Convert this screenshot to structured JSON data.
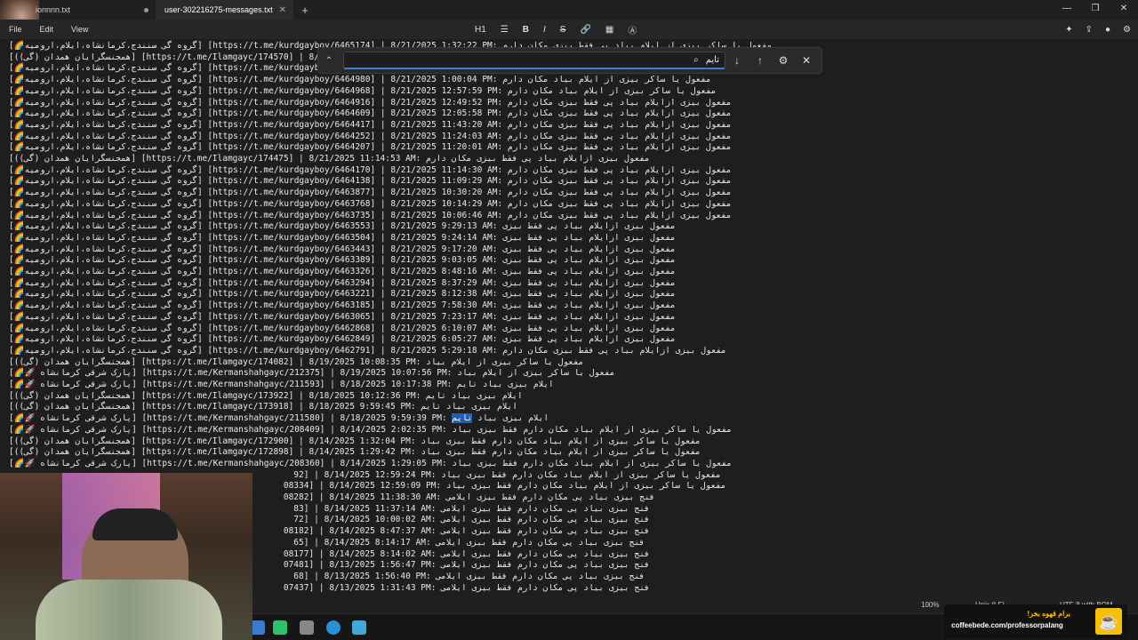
{
  "window": {
    "tabs": [
      {
        "label": "ionnnn.txt",
        "active": false
      },
      {
        "label": "user-302216275-messages.txt",
        "active": true
      }
    ],
    "new_tab": "+",
    "controls": [
      "—",
      "❐",
      "✕"
    ]
  },
  "menu": {
    "file": "File",
    "edit": "Edit",
    "view": "View"
  },
  "toolbar": {
    "heading": "H1",
    "list": "☰",
    "bold": "B",
    "italic": "I",
    "strike": "S",
    "link": "🔗",
    "table": "▦",
    "clear": "Ⓐ"
  },
  "find": {
    "query": "تایم",
    "search_icon": "⌕",
    "prev": "↓",
    "next": "↑",
    "options": "⚙",
    "close": "✕",
    "expand": "⌃"
  },
  "lines": [
    "[🌈گروه گی سنندج،کرمانشاه،ایلام،ارومیه] [https://t.me/kurdgayboy/6465174] | 8/21/2025 1:32:22 PM: مفعول یا ساکر بیزی از ایلام بیاد پی فقط بیزی مکان دارم",
    "[(همجنسگرایان همدان (گی)] [https://t.me/Ilamgayc/174570] | 8/21/20",
    "[🌈گروه گی سنندج،کرمانشاه،ایلام،ارومیه] [https://t.me/kurdgayboy/6465171] | 8/21/2025",
    "[🌈گروه گی سنندج،کرمانشاه،ایلام،ارومیه] [https://t.me/kurdgayboy/6464980] | 8/21/2025 1:00:04 PM: مفعول یا ساکر بیزی از ایلام بیاد مکان دارم",
    "[🌈گروه گی سنندج،کرمانشاه،ایلام،ارومیه] [https://t.me/kurdgayboy/6464968] | 8/21/2025 12:57:59 PM: مفعول یا ساکر بیزی از ایلام بیاد مکان دارم",
    "[🌈گروه گی سنندج،کرمانشاه،ایلام،ارومیه] [https://t.me/kurdgayboy/6464916] | 8/21/2025 12:49:52 PM: مفعول بیزی ازایلام بیاد پی فقط بیزی مکان دارم",
    "[🌈گروه گی سنندج،کرمانشاه،ایلام،ارومیه] [https://t.me/kurdgayboy/6464609] | 8/21/2025 12:05:58 PM: مفعول بیزی ازایلام بیاد پی فقط بیزی مکان دارم",
    "[🌈گروه گی سنندج،کرمانشاه،ایلام،ارومیه] [https://t.me/kurdgayboy/6464417] | 8/21/2025 11:43:20 AM: مفعول بیزی ازایلام بیاد پی فقط بیزی مکان دارم",
    "[🌈گروه گی سنندج،کرمانشاه،ایلام،ارومیه] [https://t.me/kurdgayboy/6464252] | 8/21/2025 11:24:03 AM: مفعول بیزی ازایلام بیاد پی فقط بیزی مکان دارم",
    "[🌈گروه گی سنندج،کرمانشاه،ایلام،ارومیه] [https://t.me/kurdgayboy/6464207] | 8/21/2025 11:20:01 AM: مفعول بیزی ازایلام بیاد پی فقط بیزی مکان دارم",
    "[(همجنسگرایان همدان (گی)] [https://t.me/Ilamgayc/174475] | 8/21/2025 11:14:53 AM: مفعول بیزی ازایلام بیاد پی فقط بیزی مکان دارم",
    "[🌈گروه گی سنندج،کرمانشاه،ایلام،ارومیه] [https://t.me/kurdgayboy/6464170] | 8/21/2025 11:14:30 AM: مفعول بیزی ازایلام بیاد پی فقط بیزی مکان دارم",
    "[🌈گروه گی سنندج،کرمانشاه،ایلام،ارومیه] [https://t.me/kurdgayboy/6464138] | 8/21/2025 11:09:29 AM: مفعول بیزی ازایلام بیاد پی فقط بیزی مکان دارم",
    "[🌈گروه گی سنندج،کرمانشاه،ایلام،ارومیه] [https://t.me/kurdgayboy/6463877] | 8/21/2025 10:30:20 AM: مفعول بیزی ازایلام بیاد پی فقط بیزی مکان دارم",
    "[🌈گروه گی سنندج،کرمانشاه،ایلام،ارومیه] [https://t.me/kurdgayboy/6463768] | 8/21/2025 10:14:29 AM: مفعول بیزی ازایلام بیاد پی فقط بیزی مکان دارم",
    "[🌈گروه گی سنندج،کرمانشاه،ایلام،ارومیه] [https://t.me/kurdgayboy/6463735] | 8/21/2025 10:06:46 AM: مفعول بیزی ازایلام بیاد پی فقط بیزی مکان دارم",
    "[🌈گروه گی سنندج،کرمانشاه،ایلام،ارومیه] [https://t.me/kurdgayboy/6463553] | 8/21/2025 9:29:13 AM: مفعول بیزی ازایلام بیاد پی فقط بیزی",
    "[🌈گروه گی سنندج،کرمانشاه،ایلام،ارومیه] [https://t.me/kurdgayboy/6463504] | 8/21/2025 9:24:14 AM: مفعول بیزی ازایلام بیاد پی فقط بیزی",
    "[🌈گروه گی سنندج،کرمانشاه،ایلام،ارومیه] [https://t.me/kurdgayboy/6463443] | 8/21/2025 9:17:20 AM: مفعول بیزی ازایلام بیاد پی فقط بیزی",
    "[🌈گروه گی سنندج،کرمانشاه،ایلام،ارومیه] [https://t.me/kurdgayboy/6463389] | 8/21/2025 9:03:05 AM: مفعول بیزی ازایلام بیاد پی فقط بیزی",
    "[🌈گروه گی سنندج،کرمانشاه،ایلام،ارومیه] [https://t.me/kurdgayboy/6463326] | 8/21/2025 8:48:16 AM: مفعول بیزی ازایلام بیاد پی فقط بیزی",
    "[🌈گروه گی سنندج،کرمانشاه،ایلام،ارومیه] [https://t.me/kurdgayboy/6463294] | 8/21/2025 8:37:29 AM: مفعول بیزی ازایلام بیاد پی فقط بیزی",
    "[🌈گروه گی سنندج،کرمانشاه،ایلام،ارومیه] [https://t.me/kurdgayboy/6463221] | 8/21/2025 8:12:38 AM: مفعول بیزی ازایلام بیاد پی فقط بیزی",
    "[🌈گروه گی سنندج،کرمانشاه،ایلام،ارومیه] [https://t.me/kurdgayboy/6463185] | 8/21/2025 7:58:30 AM: مفعول بیزی ازایلام بیاد پی فقط بیزی",
    "[🌈گروه گی سنندج،کرمانشاه،ایلام،ارومیه] [https://t.me/kurdgayboy/6463065] | 8/21/2025 7:23:17 AM: مفعول بیزی ازایلام بیاد پی فقط بیزی",
    "[🌈گروه گی سنندج،کرمانشاه،ایلام،ارومیه] [https://t.me/kurdgayboy/6462868] | 8/21/2025 6:10:07 AM: مفعول بیزی ازایلام بیاد پی فقط بیزی",
    "[🌈گروه گی سنندج،کرمانشاه،ایلام،ارومیه] [https://t.me/kurdgayboy/6462849] | 8/21/2025 6:05:27 AM: مفعول بیزی ازایلام بیاد پی فقط بیزی",
    "[🌈گروه گی سنندج،کرمانشاه،ایلام،ارومیه] [https://t.me/kurdgayboy/6462791] | 8/21/2025 5:29:18 AM: مفعول بیزی ازایلام بیاد پی فقط بیزی مکان دارم",
    "[(همجنسگرایان همدان (گی)] [https://t.me/Ilamgayc/174082] | 8/19/2025 10:08:35 PM: مفعول یا ساکر بیزی از ایلام بیاد",
    "[🌈🚀 پارک شرقی کرمانشاه] [https://t.me/Kermanshahgayc/212375] | 8/19/2025 10:07:56 PM: مفعول یا ساکر بیزی از ایلام بیاد",
    "[🌈🚀 پارک شرقی کرمانشاه] [https://t.me/Kermanshahgayc/211593] | 8/18/2025 10:17:38 PM: ایلام بیزی بیاد تایم",
    "[(همجنسگرایان همدان (گی)] [https://t.me/Ilamgayc/173922] | 8/18/2025 10:12:36 PM: ایلام بیزی بیاد تایم",
    "[(همجنسگرایان همدان (گی)] [https://t.me/Ilamgayc/173918] | 8/18/2025 9:59:45 PM: ایلام بیزی بیاد تایم",
    "[🌈🚀 پارک شرقی کرمانشاه] [https://t.me/Kermanshahgayc/211580] | 8/18/2025 9:59:39 PM: ایلام بیزی بیاد |تایم|",
    "[🌈🚀 پارک شرقی کرمانشاه] [https://t.me/Kermanshahgayc/208409] | 8/14/2025 2:02:35 PM: مفعول یا ساکر بیزی از ایلام بیاد مکان دارم فقط بیزی بیاد",
    "[(همجنسگرایان همدان (گی)] [https://t.me/Ilamgayc/172900] | 8/14/2025 1:32:04 PM: مفعول یا ساکر بیزی از ایلام بیاد مکان دارم فقط بیزی بیاد",
    "[(همجنسگرایان همدان (گی)] [https://t.me/Ilamgayc/172898] | 8/14/2025 1:29:42 PM: مفعول یا ساکر بیزی از ایلام بیاد مکان دارم فقط بیزی بیاد",
    "[🌈🚀 پارک شرقی کرمانشاه] [https://t.me/Kermanshahgayc/208360] | 8/14/2025 1:29:05 PM: مفعول یا ساکر بیزی از ایلام بیاد مکان دارم فقط بیزی بیاد",
    "                                                        92] | 8/14/2025 12:59:24 PM: مفعول یا ساکر بیزی از ایلام بیاد مکان دارم فقط بیزی بیاد",
    "                                                      08334] | 8/14/2025 12:59:09 PM: مفعول یا ساکر بیزی از ایلام بیاد مکان دارم فقط بیزی بیاد",
    "                                                      08282] | 8/14/2025 11:38:30 AM: فنج بیزی بیاد پی مکان دارم فقط بیزی ایلامی",
    "                                                        83] | 8/14/2025 11:37:14 AM: فنج بیزی بیاد پی مکان دارم فقط بیزی ایلامی",
    "                                                        72] | 8/14/2025 10:00:02 AM: فنج بیزی بیاد پی مکان دارم فقط بیزی ایلامی",
    "                                                      08182] | 8/14/2025 8:47:37 AM: فنج بیزی بیاد پی مکان دارم فقط بیزی ایلامی",
    "                                                        65] | 8/14/2025 8:14:17 AM: فنج بیزی بیاد پی مکان دارم فقط بیزی ایلامی",
    "                                                      08177] | 8/14/2025 8:14:02 AM: فنج بیزی بیاد پی مکان دارم فقط بیزی ایلامی",
    "                                                      07481] | 8/13/2025 1:56:47 PM: فنج بیزی بیاد پی مکان دارم فقط بیزی ایلامی",
    "                                                        68] | 8/13/2025 1:56:40 PM: فنج بیزی بیاد پی مکان دارم فقط بیزی ایلامی",
    "                                                      07437] | 8/13/2025 1:31:43 PM: فنج بیزی بیاد پی مکان دارم فقط بیزی ایلامی"
  ],
  "status": {
    "zoom": "100%",
    "eol": "Unix (LF)",
    "encoding": "UTF-8 with BOM"
  },
  "promo": {
    "line1": "برام قهوه بخر!",
    "line2": "coffeebede.com/professorpalang"
  }
}
